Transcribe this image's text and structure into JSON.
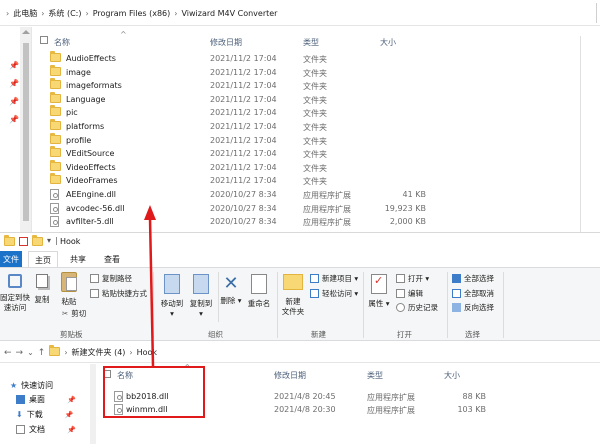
{
  "window1": {
    "breadcrumb": [
      "此电脑",
      "系统 (C:)",
      "Program Files (x86)",
      "Viwizard M4V Converter"
    ],
    "columns": {
      "name": "名称",
      "date": "修改日期",
      "type": "类型",
      "size": "大小"
    },
    "files": [
      {
        "name": "AudioEffects",
        "date": "2021/11/2 17:04",
        "type": "文件夹",
        "size": "",
        "kind": "folder"
      },
      {
        "name": "image",
        "date": "2021/11/2 17:04",
        "type": "文件夹",
        "size": "",
        "kind": "folder"
      },
      {
        "name": "imageformats",
        "date": "2021/11/2 17:04",
        "type": "文件夹",
        "size": "",
        "kind": "folder"
      },
      {
        "name": "Language",
        "date": "2021/11/2 17:04",
        "type": "文件夹",
        "size": "",
        "kind": "folder"
      },
      {
        "name": "pic",
        "date": "2021/11/2 17:04",
        "type": "文件夹",
        "size": "",
        "kind": "folder"
      },
      {
        "name": "platforms",
        "date": "2021/11/2 17:04",
        "type": "文件夹",
        "size": "",
        "kind": "folder"
      },
      {
        "name": "profile",
        "date": "2021/11/2 17:04",
        "type": "文件夹",
        "size": "",
        "kind": "folder"
      },
      {
        "name": "VEditSource",
        "date": "2021/11/2 17:04",
        "type": "文件夹",
        "size": "",
        "kind": "folder"
      },
      {
        "name": "VideoEffects",
        "date": "2021/11/2 17:04",
        "type": "文件夹",
        "size": "",
        "kind": "folder"
      },
      {
        "name": "VideoFrames",
        "date": "2021/11/2 17:04",
        "type": "文件夹",
        "size": "",
        "kind": "folder"
      },
      {
        "name": "AEEngine.dll",
        "date": "2020/10/27 8:34",
        "type": "应用程序扩展",
        "size": "41 KB",
        "kind": "dll"
      },
      {
        "name": "avcodec-56.dll",
        "date": "2020/10/27 8:34",
        "type": "应用程序扩展",
        "size": "19,923 KB",
        "kind": "dll"
      },
      {
        "name": "avfilter-5.dll",
        "date": "2020/10/27 8:34",
        "type": "应用程序扩展",
        "size": "2,000 KB",
        "kind": "dll"
      }
    ]
  },
  "window2": {
    "title": "Hook",
    "tabs": {
      "file": "文件",
      "home": "主页",
      "share": "共享",
      "view": "查看"
    },
    "ribbon": {
      "pin": "固定到快\n速访问",
      "copy": "复制",
      "paste": "粘贴",
      "copy_path": "复制路径",
      "paste_shortcut": "粘贴快捷方式",
      "cut": "剪切",
      "clipboard": "剪贴板",
      "move_to": "移动到",
      "copy_to": "复制到",
      "delete": "删除",
      "rename": "重命名",
      "organize": "组织",
      "new_folder": "新建\n文件夹",
      "new_item": "新建项目",
      "easy_access": "轻松访问",
      "new": "新建",
      "properties": "属性",
      "open": "打开",
      "edit": "编辑",
      "history": "历史记录",
      "open_group": "打开",
      "select_all": "全部选择",
      "select_none": "全部取消",
      "invert": "反向选择",
      "select": "选择"
    },
    "breadcrumb": [
      "新建文件夹 (4)",
      "Hook"
    ],
    "nav": [
      "快速访问",
      "桌面",
      "下载",
      "文档"
    ],
    "columns": {
      "name": "名称",
      "date": "修改日期",
      "type": "类型",
      "size": "大小"
    },
    "files": [
      {
        "name": "bb2018.dll",
        "date": "2021/4/8 20:45",
        "type": "应用程序扩展",
        "size": "88 KB"
      },
      {
        "name": "winmm.dll",
        "date": "2021/4/8 20:30",
        "type": "应用程序扩展",
        "size": "103 KB"
      }
    ]
  },
  "colors": {
    "highlight": "#e0191a",
    "arrow": "#e0191a",
    "file_tab": "#1b72c9"
  }
}
